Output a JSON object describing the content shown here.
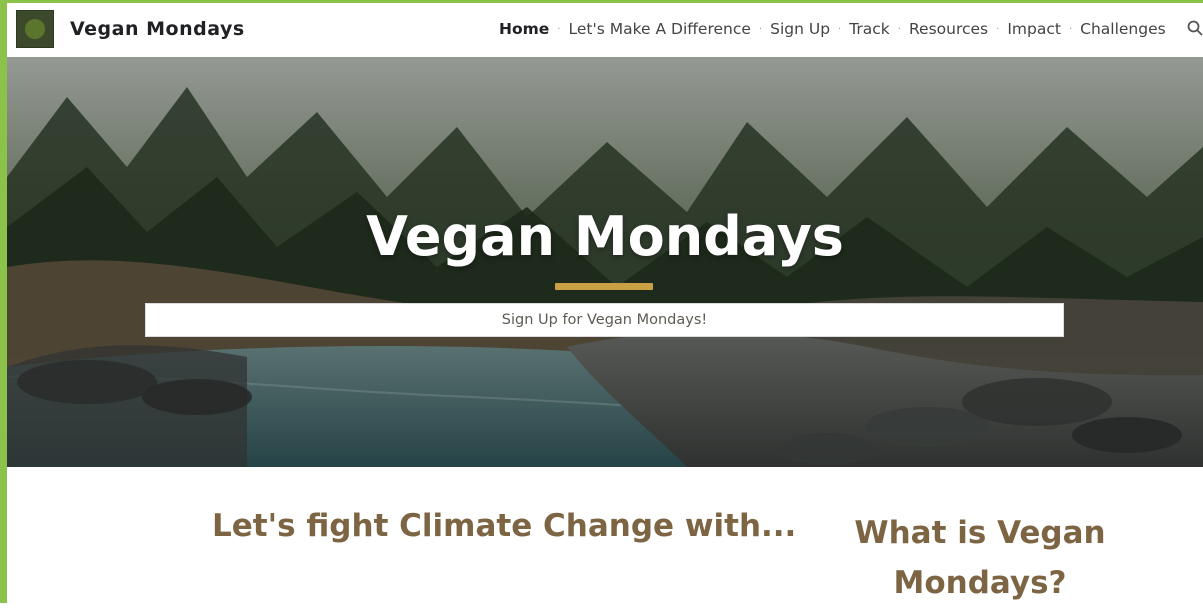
{
  "header": {
    "site_title": "Vegan Mondays",
    "nav": [
      {
        "label": "Home",
        "active": true
      },
      {
        "label": "Let's Make A Difference"
      },
      {
        "label": "Sign Up"
      },
      {
        "label": "Track"
      },
      {
        "label": "Resources"
      },
      {
        "label": "Impact"
      },
      {
        "label": "Challenges"
      }
    ],
    "search_icon": "search-icon"
  },
  "hero": {
    "title": "Vegan Mondays",
    "button_label": "Sign Up for Vegan Mondays!"
  },
  "sections": {
    "left_heading": "Let's fight Climate Change with...",
    "right_heading": "What is Vegan Mondays?"
  },
  "colors": {
    "accent_gold": "#c9a044",
    "heading_brown": "#7d6544",
    "frame_green": "#8bc34a"
  }
}
